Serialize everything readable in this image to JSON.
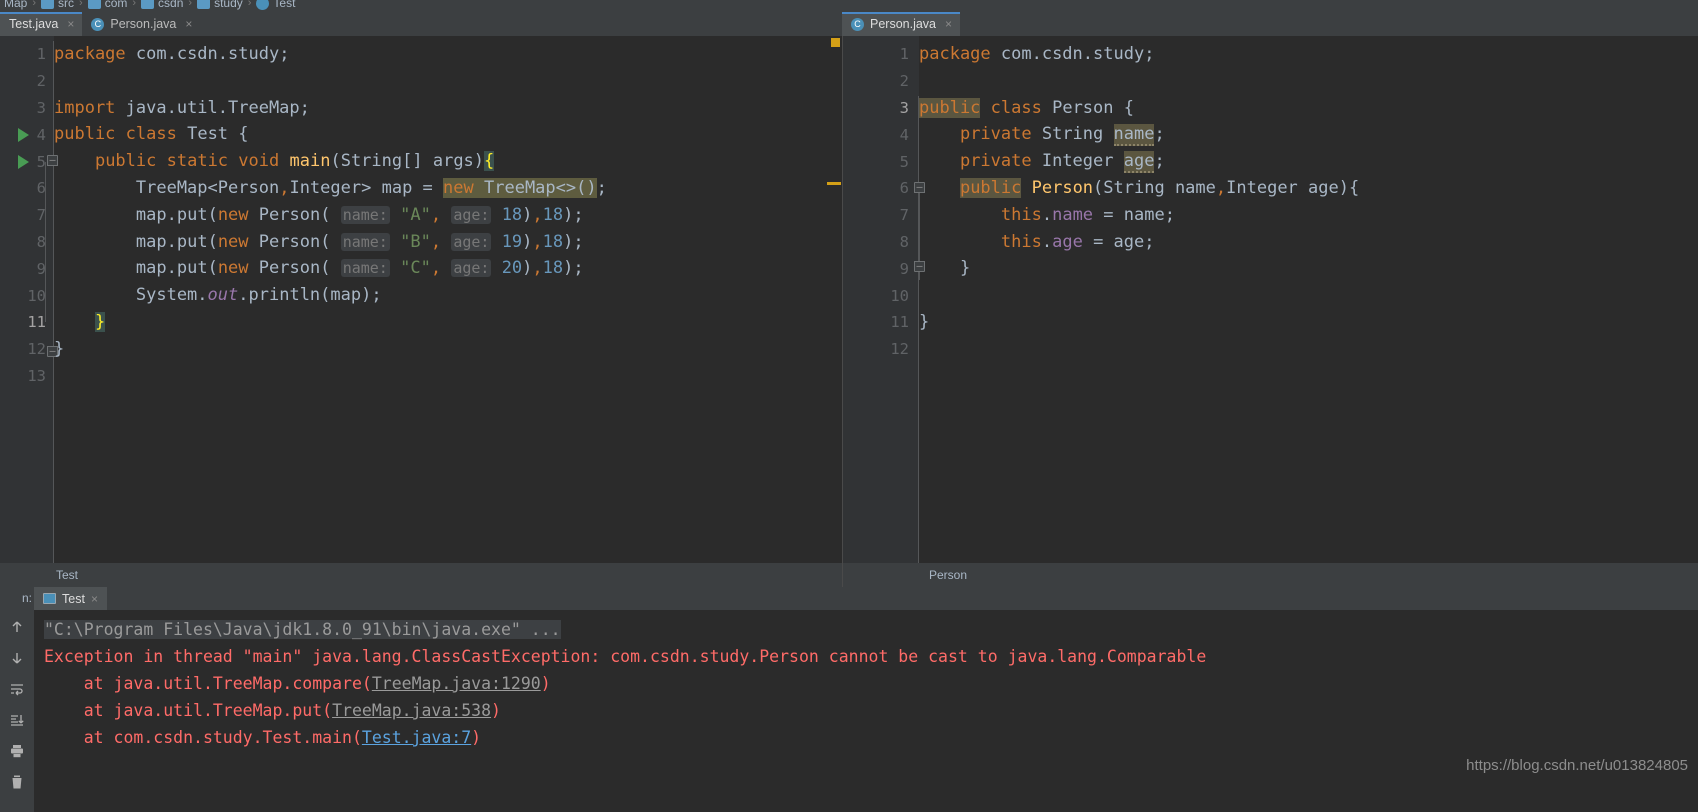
{
  "breadcrumb": {
    "items": [
      {
        "label": "Map",
        "icon": "folder-icon"
      },
      {
        "label": "src",
        "icon": "folder-icon"
      },
      {
        "label": "com",
        "icon": "folder-icon"
      },
      {
        "label": "csdn",
        "icon": "folder-icon"
      },
      {
        "label": "study",
        "icon": "folder-icon"
      },
      {
        "label": "Test",
        "icon": "class-icon"
      }
    ],
    "separator": "›"
  },
  "tabs_left": [
    {
      "label": "Test.java",
      "active": true,
      "close": "×",
      "icon": ""
    },
    {
      "label": "Person.java",
      "active": false,
      "close": "×",
      "icon": "C"
    }
  ],
  "tabs_right": [
    {
      "label": "Person.java",
      "active": true,
      "close": "×",
      "icon": "C"
    }
  ],
  "editor_left": {
    "file": "Test.java",
    "status_label": "Test",
    "line_numbers": [
      "1",
      "2",
      "3",
      "4",
      "5",
      "6",
      "7",
      "8",
      "9",
      "10",
      "11",
      "12",
      "13"
    ],
    "lines": [
      "package com.csdn.study;",
      "",
      "import java.util.TreeMap;",
      "public class Test {",
      "    public static void main(String[] args){",
      "        TreeMap<Person,Integer> map = new TreeMap<>();",
      "        map.put(new Person( name: \"A\", age: 18),18);",
      "        map.put(new Person( name: \"B\", age: 19),18);",
      "        map.put(new Person( name: \"C\", age: 20),18);",
      "        System.out.println(map);",
      "    }",
      "}",
      ""
    ]
  },
  "editor_right": {
    "file": "Person.java",
    "status_label": "Person",
    "line_numbers": [
      "1",
      "2",
      "3",
      "4",
      "5",
      "6",
      "7",
      "8",
      "9",
      "10",
      "11",
      "12"
    ],
    "lines": [
      "package com.csdn.study;",
      "",
      "public class Person {",
      "    private String name;",
      "    private Integer age;",
      "    public Person(String name,Integer age){",
      "        this.name = name;",
      "        this.age = age;",
      "    }",
      "",
      "}",
      ""
    ]
  },
  "run_panel": {
    "title": "n:",
    "tab_label": "Test",
    "tab_close": "×",
    "toolbar": [
      {
        "name": "rerun-up-icon",
        "title": "Up the Stack Trace"
      },
      {
        "name": "rerun-down-icon",
        "title": "Down the Stack Trace"
      },
      {
        "name": "soft-wrap-icon",
        "title": "Use Soft Wraps"
      },
      {
        "name": "scroll-to-end-icon",
        "title": "Scroll to End"
      },
      {
        "name": "print-icon",
        "title": "Print"
      },
      {
        "name": "trash-icon",
        "title": "Clear All"
      }
    ],
    "console_lines": [
      {
        "kind": "cmd",
        "text": "\"C:\\Program Files\\Java\\jdk1.8.0_91\\bin\\java.exe\" ..."
      },
      {
        "kind": "err",
        "text": "Exception in thread \"main\" java.lang.ClassCastException: com.csdn.study.Person cannot be cast to java.lang.Comparable"
      },
      {
        "kind": "trace",
        "prefix": "    at java.util.TreeMap.compare(",
        "link": "TreeMap.java:1290",
        "suffix": ")",
        "link_style": "gray"
      },
      {
        "kind": "trace",
        "prefix": "    at java.util.TreeMap.put(",
        "link": "TreeMap.java:538",
        "suffix": ")",
        "link_style": "gray"
      },
      {
        "kind": "trace",
        "prefix": "    at com.csdn.study.Test.main(",
        "link": "Test.java:7",
        "suffix": ")",
        "link_style": "blue"
      }
    ]
  },
  "watermark": "https://blog.csdn.net/u013824805",
  "colors": {
    "background": "#2b2b2b",
    "chrome": "#3c3f41",
    "gutter": "#313335",
    "keyword": "#cc7832",
    "identifier": "#a9b7c6",
    "string": "#6a8759",
    "number": "#6897bb",
    "method": "#ffc66d",
    "field": "#9876aa",
    "error": "#ff6b68",
    "accent": "#4a88c7",
    "run_arrow": "#499c54",
    "marker": "#d4a017"
  }
}
